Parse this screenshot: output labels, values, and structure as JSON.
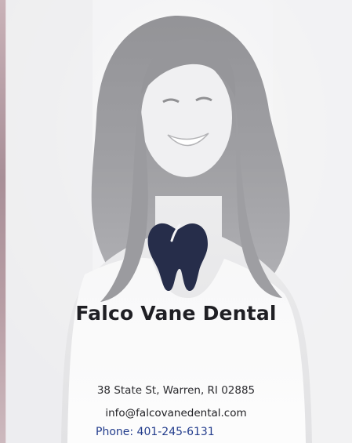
{
  "hero": {
    "image_icon": "smiling-woman-photo",
    "logo_icon": "tooth-icon",
    "logo_color": "#262d4a"
  },
  "brand": {
    "name": "Falco Vane Dental"
  },
  "contact": {
    "address": "38 State St, Warren, RI 02885",
    "email": "info@falcovanedental.com",
    "phone": "Phone: 401-245-6131"
  },
  "colors": {
    "brand_text": "#1f1f24",
    "phone_link": "#223c8c"
  }
}
